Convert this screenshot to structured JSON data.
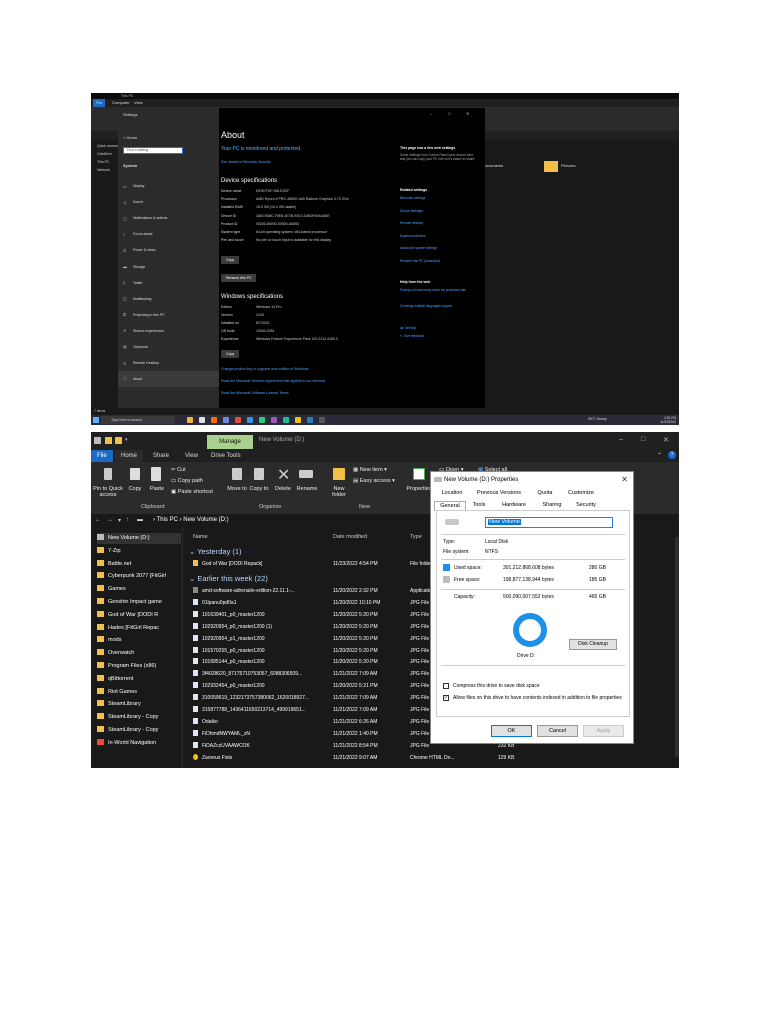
{
  "shot1": {
    "window_title": "This PC",
    "tabs": [
      "File",
      "Computer",
      "View"
    ],
    "nav_items": [
      "Quick access",
      "OneDrive",
      "This PC",
      "Network"
    ],
    "search_placeholder": "Search This PC",
    "folder_label": "Pictures",
    "folder_label2": "Documents",
    "status": "7 items",
    "settings": {
      "window_title": "Settings",
      "home": "Home",
      "find_placeholder": "Find a setting",
      "section": "System",
      "menu": [
        {
          "icon": "display-icon",
          "glyph": "▭",
          "label": "Display"
        },
        {
          "icon": "sound-icon",
          "glyph": "◁",
          "label": "Sound"
        },
        {
          "icon": "notifications-icon",
          "glyph": "▢",
          "label": "Notifications & actions"
        },
        {
          "icon": "focus-assist-icon",
          "glyph": "☾",
          "label": "Focus assist"
        },
        {
          "icon": "power-icon",
          "glyph": "⏻",
          "label": "Power & sleep"
        },
        {
          "icon": "storage-icon",
          "glyph": "▬",
          "label": "Storage"
        },
        {
          "icon": "tablet-icon",
          "glyph": "▯",
          "label": "Tablet"
        },
        {
          "icon": "multitasking-icon",
          "glyph": "◫",
          "label": "Multitasking"
        },
        {
          "icon": "projecting-icon",
          "glyph": "⎚",
          "label": "Projecting to this PC"
        },
        {
          "icon": "shared-experiences-icon",
          "glyph": "✕",
          "label": "Shared experiences"
        },
        {
          "icon": "clipboard-icon",
          "glyph": "▤",
          "label": "Clipboard"
        },
        {
          "icon": "remote-desktop-icon",
          "glyph": "✕",
          "label": "Remote Desktop"
        },
        {
          "icon": "about-icon",
          "glyph": "ⓘ",
          "label": "About"
        }
      ],
      "about_title": "About",
      "status": "Your PC is monitored and protected.",
      "see_details": "See details in Windows Security",
      "device_specs_title": "Device specifications",
      "device_specs": [
        {
          "k": "Device name",
          "v": "DESKTOP-K8LDO2F"
        },
        {
          "k": "Processor",
          "v": "AMD Ryzen 5 PRO 4650G with Radeon Graphics   3.70 GHz"
        },
        {
          "k": "Installed RAM",
          "v": "16.0 GB (15.4 GB usable)"
        },
        {
          "k": "Device ID",
          "v": "3A5C9D8C-F8E8-4E7B-93C0-D4B2F69A4AEE"
        },
        {
          "k": "Product ID",
          "v": "00330-80000-00000-AA553"
        },
        {
          "k": "System type",
          "v": "64-bit operating system, x64-based processor"
        },
        {
          "k": "Pen and touch",
          "v": "No pen or touch input is available for this display"
        }
      ],
      "copy_label": "Copy",
      "rename_label": "Rename this PC",
      "win_specs_title": "Windows specifications",
      "win_specs": [
        {
          "k": "Edition",
          "v": "Windows 10 Pro"
        },
        {
          "k": "Version",
          "v": "21H2"
        },
        {
          "k": "Installed on",
          "v": "8/7/2022"
        },
        {
          "k": "OS build",
          "v": "19044.2251"
        },
        {
          "k": "Experience",
          "v": "Windows Feature Experience Pack 120.2212.4180.0"
        }
      ],
      "copy_label2": "Copy",
      "links": [
        "Change product key or upgrade your edition of Windows",
        "Read the Microsoft Services Agreement that applies to our services",
        "Read the Microsoft Software License Terms"
      ],
      "right_head": "This page has a few new settings",
      "right_text": "Some settings from Control Panel have moved here, and you can copy your PC info so it's easier to share.",
      "related_head": "Related settings",
      "related_links": [
        "BitLocker settings",
        "Device Manager",
        "Remote desktop",
        "System protection",
        "Advanced system settings",
        "Rename this PC (advanced)"
      ],
      "help_head": "Help from the web",
      "help_links": [
        "Finding out how many cores my processor has",
        "Checking multiple languages support"
      ],
      "get_help": "Get help",
      "give_feedback": "Give feedback"
    },
    "taskbar": {
      "search_placeholder": "Type here to search",
      "weather": "39°C Sunny",
      "time": "2:30 PM",
      "date": "11/23/2022"
    }
  },
  "shot2": {
    "manage_tab": "Manage",
    "window_title": "New Volume (D:)",
    "tabs": [
      "File",
      "Home",
      "Share",
      "View",
      "Drive Tools"
    ],
    "ribbon": {
      "pin_quick": "Pin to Quick access",
      "copy": "Copy",
      "paste": "Paste",
      "cut": "Cut",
      "copy_path": "Copy path",
      "paste_shortcut": "Paste shortcut",
      "move_to": "Move to",
      "copy_to": "Copy to",
      "delete": "Delete",
      "rename": "Rename",
      "new_folder": "New folder",
      "new_item": "New item",
      "easy_access": "Easy access",
      "properties": "Properties",
      "open": "Open",
      "select_all": "Select all",
      "group_clipboard": "Clipboard",
      "group_organize": "Organize",
      "group_new": "New"
    },
    "breadcrumb": [
      "This PC",
      "New Volume (D:)"
    ],
    "nav_items": [
      "New Volume (D:)",
      "7-Zip",
      "Battle.net",
      "Cyberpunk 2077 [FitGirl",
      "Games",
      "Genshin Impact game",
      "God of War [DODI R",
      "Hades [FitGirl Repac",
      "mods",
      "Overwatch",
      "Program Files (x86)",
      "qBittorrent",
      "Riot Games",
      "SteamLibrary",
      "SteamLibrary - Copy",
      "SteamLibrary - Copy",
      "In-World Navigation"
    ],
    "columns": {
      "name": "Name",
      "date": "Date modified",
      "type": "Type",
      "size": "Size"
    },
    "group_yesterday": "Yesterday (1)",
    "group_earlier": "Earlier this week (22)",
    "rows_yesterday": [
      {
        "name": "God of War [DODI Repack]",
        "date": "11/23/2022 4:54 PM",
        "type": "File folder",
        "size": "",
        "kind": "folder"
      }
    ],
    "rows": [
      {
        "name": "amd-software-adrenalin-edition-22.11.1-...",
        "date": "11/20/2022 2:32 PM",
        "type": "Application",
        "size": "",
        "kind": "app"
      },
      {
        "name": "01lpanu0pd0a1",
        "date": "11/20/2022 10:10 PM",
        "type": "JPG File",
        "size": "",
        "kind": "img"
      },
      {
        "name": "101639401_p0_master1200",
        "date": "11/20/2022 5:20 PM",
        "type": "JPG File",
        "size": "",
        "kind": "img"
      },
      {
        "name": "102920954_p0_master1200 (1)",
        "date": "11/20/2022 5:20 PM",
        "type": "JPG File",
        "size": "",
        "kind": "img"
      },
      {
        "name": "102920954_p1_master1200",
        "date": "11/20/2022 5:20 PM",
        "type": "JPG File",
        "size": "",
        "kind": "img"
      },
      {
        "name": "101570255_p0_master1200",
        "date": "11/20/2022 5:20 PM",
        "type": "JPG File",
        "size": "",
        "kind": "img"
      },
      {
        "name": "101685144_p0_master1200",
        "date": "11/20/2022 5:20 PM",
        "type": "JPG File",
        "size": "",
        "kind": "img"
      },
      {
        "name": "3f4028620_87175710753057_6088306509...",
        "date": "11/21/2022 7:09 AM",
        "type": "JPG File",
        "size": "",
        "kind": "img"
      },
      {
        "name": "102932454_p0_master1200",
        "date": "11/20/2022 5:21 PM",
        "type": "JPG File",
        "size": "",
        "kind": "img"
      },
      {
        "name": "310059619_1232173757380062_1620018927...",
        "date": "11/21/2022 7:09 AM",
        "type": "JPG File",
        "size": "",
        "kind": "img"
      },
      {
        "name": "315877788_1436411650213714_499919651...",
        "date": "11/21/2022 7:09 AM",
        "type": "JPG File",
        "size": "",
        "kind": "img"
      },
      {
        "name": "Odaiko",
        "date": "11/21/2022 6:26 AM",
        "type": "JPG File",
        "size": "",
        "kind": "img"
      },
      {
        "name": "FiDhmdNWYAML_zN",
        "date": "11/21/2022 1:40 PM",
        "type": "JPG File",
        "size": "",
        "kind": "img"
      },
      {
        "name": "FiDAZczUVAAWCOK",
        "date": "11/21/2022 8:54 PM",
        "type": "JPG File",
        "size": "232 KB",
        "kind": "img"
      },
      {
        "name": "Zaoreus Fists",
        "date": "11/21/2022 9:07 AM",
        "type": "Chrome HTML Do...",
        "size": "129 KB",
        "kind": "chrome"
      }
    ],
    "props": {
      "title": "New Volume (D:) Properties",
      "tabs_row1": [
        "Location",
        "Previous Versions",
        "Quota",
        "Customize"
      ],
      "tabs_row2": [
        "General",
        "Tools",
        "Hardware",
        "Sharing",
        "Security"
      ],
      "name_value": "New Volume",
      "type_label": "Type:",
      "type_value": "Local Disk",
      "fs_label": "File system:",
      "fs_value": "NTFS",
      "used_label": "Used space:",
      "used_bytes": "301,212,868,608 bytes",
      "used_gb": "280 GB",
      "free_label": "Free space:",
      "free_bytes": "198,877,138,944 bytes",
      "free_gb": "185 GB",
      "cap_label": "Capacity:",
      "cap_bytes": "500,090,007,552 bytes",
      "cap_gb": "465 GB",
      "drive_label": "Drive D:",
      "disk_cleanup": "Disk Cleanup",
      "compress": "Compress this drive to save disk space",
      "index": "Allow files on this drive to have contents indexed in addition to file properties",
      "ok": "OK",
      "cancel": "Cancel",
      "apply": "Apply",
      "used_color": "#1e90e8",
      "free_color": "#bcbcbc"
    }
  }
}
